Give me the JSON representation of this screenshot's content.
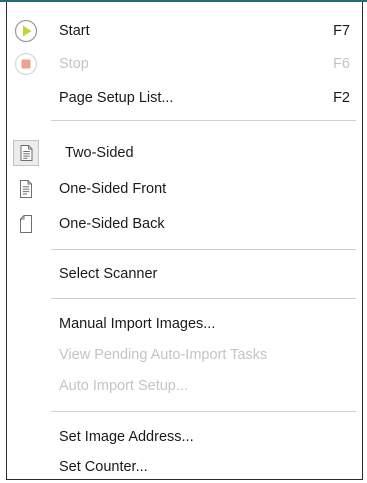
{
  "menu": {
    "start": {
      "label": "Start",
      "shortcut": "F7",
      "icon": "play-icon"
    },
    "stop": {
      "label": "Stop",
      "shortcut": "F6",
      "icon": "stop-icon"
    },
    "page_setup": {
      "label": "Page Setup List...",
      "shortcut": "F2"
    },
    "two_sided": {
      "label": "Two-Sided",
      "icon": "two-sided-page-icon"
    },
    "one_sided_front": {
      "label": "One-Sided Front",
      "icon": "page-front-icon"
    },
    "one_sided_back": {
      "label": "One-Sided Back",
      "icon": "page-back-icon"
    },
    "select_scanner": {
      "label": "Select Scanner"
    },
    "manual_import": {
      "label": "Manual Import Images..."
    },
    "view_pending": {
      "label": "View Pending Auto-Import Tasks"
    },
    "auto_import_setup": {
      "label": "Auto Import Setup..."
    },
    "set_image_address": {
      "label": "Set Image Address..."
    },
    "set_counter": {
      "label": "Set Counter..."
    }
  },
  "colors": {
    "play_fill": "#c8d531",
    "stop_fill": "#f0a08c",
    "disabled_text": "#c4c4c4"
  }
}
